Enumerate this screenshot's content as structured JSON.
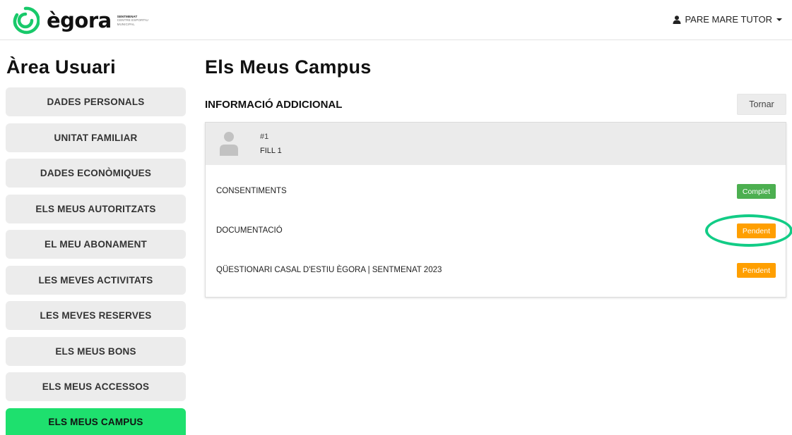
{
  "header": {
    "brand": "ègora",
    "brand_sub": [
      "SENTMENAT",
      "CENTRE ESPORTIU",
      "MUNICIPAL"
    ],
    "user_menu": "PARE MARE TUTOR"
  },
  "sidebar": {
    "title": "Àrea Usuari",
    "items": [
      {
        "label": "DADES PERSONALS"
      },
      {
        "label": "UNITAT FAMILIAR"
      },
      {
        "label": "DADES ECONÒMIQUES"
      },
      {
        "label": "ELS MEUS AUTORITZATS"
      },
      {
        "label": "EL MEU ABONAMENT"
      },
      {
        "label": "LES MEVES ACTIVITATS"
      },
      {
        "label": "LES MEVES RESERVES"
      },
      {
        "label": "ELS MEUS BONS"
      },
      {
        "label": "ELS MEUS ACCESSOS"
      },
      {
        "label": "ELS MEUS CAMPUS"
      }
    ],
    "active_index": 9
  },
  "main": {
    "title": "Els Meus Campus",
    "section_title": "INFORMACIÓ ADDICIONAL",
    "back_button": "Tornar",
    "child": {
      "id": "#1",
      "name": "FILL 1"
    },
    "rows": [
      {
        "label": "CONSENTIMENTS",
        "status": "Complet"
      },
      {
        "label": "DOCUMENTACIÓ",
        "status": "Pendent"
      },
      {
        "label": "QÜESTIONARI CASAL D'ESTIU ÈGORA | SENTMENAT 2023",
        "status": "Pendent"
      }
    ]
  },
  "colors": {
    "brand_green": "#1ee06e",
    "complet": "#4caf50",
    "pendent": "#ff9f00",
    "highlight": "#12cc86"
  },
  "icons": {
    "logo": "egora-swirl-logo",
    "user": "user-icon",
    "avatar": "avatar-placeholder-icon"
  }
}
